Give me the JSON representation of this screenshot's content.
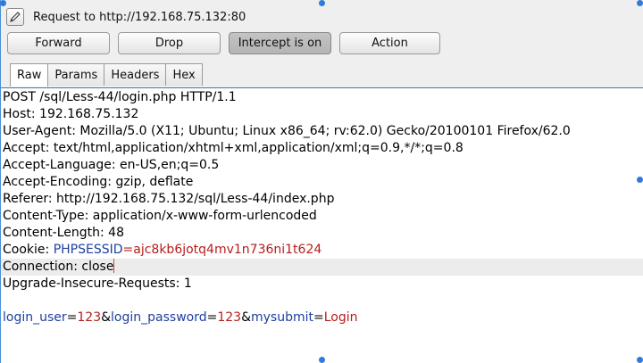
{
  "window": {
    "title": "Request to http://192.168.75.132:80",
    "icon": "pencil-icon"
  },
  "toolbar": {
    "forward_label": "Forward",
    "drop_label": "Drop",
    "intercept_label": "Intercept is on",
    "action_label": "Action"
  },
  "tabs": [
    "Raw",
    "Params",
    "Headers",
    "Hex"
  ],
  "request": {
    "lines": [
      "POST /sql/Less-44/login.php HTTP/1.1",
      "Host: 192.168.75.132",
      "User-Agent: Mozilla/5.0 (X11; Ubuntu; Linux x86_64; rv:62.0) Gecko/20100101 Firefox/62.0",
      "Accept: text/html,application/xhtml+xml,application/xml;q=0.9,*/*;q=0.8",
      "Accept-Language: en-US,en;q=0.5",
      "Accept-Encoding: gzip, deflate",
      "Referer: http://192.168.75.132/sql/Less-44/index.php",
      "Content-Type: application/x-www-form-urlencoded",
      "Content-Length: 48"
    ],
    "cookie": {
      "prefix": "Cookie: ",
      "name": "PHPSESSID",
      "eq": "=",
      "value": "ajc8kb6jotq4mv1n736ni1t624"
    },
    "connection_line": "Connection: close",
    "upgrade_line": "Upgrade-Insecure-Requests: 1",
    "body": {
      "k1": "login_user",
      "eq1": "=",
      "v1": "123",
      "amp1": "&",
      "k2": "login_password",
      "eq2": "=",
      "v2": "123",
      "amp2": "&",
      "k3": "mysubmit",
      "eq3": "=",
      "v3": "Login"
    }
  },
  "colors": {
    "param_name": "#1d3f9f",
    "param_value": "#b81c1c",
    "selection_handle": "#2f7bdc"
  }
}
